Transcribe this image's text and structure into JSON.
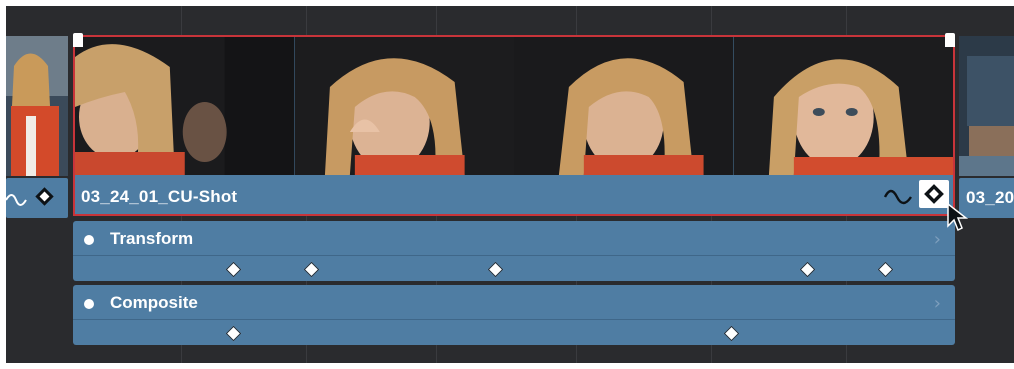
{
  "timeline": {
    "left_clip": {
      "name": ""
    },
    "selected_clip": {
      "name": "03_24_01_CU-Shot",
      "curve_icon": "curve-icon",
      "keyframe_icon": "keyframe-diamond-icon"
    },
    "right_clip": {
      "name": "03_20"
    },
    "tracks": [
      {
        "label": "Transform",
        "expand_icon": "chevron-right-icon",
        "keyframes": 5
      },
      {
        "label": "Composite",
        "expand_icon": "chevron-right-icon",
        "keyframes": 2
      }
    ],
    "chevron_glyph": "›",
    "colors": {
      "background": "#2a2b2e",
      "clip_bar": "#4f7da3",
      "selection_border": "#c8343a",
      "keyframe": "#ffffff"
    }
  }
}
